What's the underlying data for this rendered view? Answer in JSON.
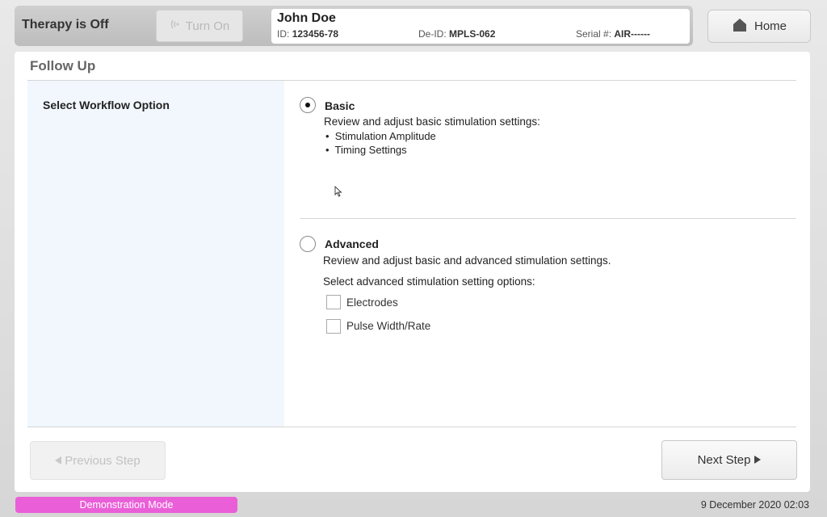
{
  "header": {
    "therapy_status": "Therapy is Off",
    "turn_on_label": "Turn On",
    "patient": {
      "name": "John Doe",
      "id_label": "ID:",
      "id_value": "123456-78",
      "deid_label": "De-ID:",
      "deid_value": "MPLS-062",
      "serial_label": "Serial #:",
      "serial_value": "AIR------"
    },
    "home_label": "Home"
  },
  "page": {
    "title": "Follow Up",
    "left_heading": "Select Workflow Option"
  },
  "options": {
    "basic": {
      "title": "Basic",
      "selected": true,
      "description": "Review and adjust basic stimulation settings:",
      "bullets": [
        "Stimulation Amplitude",
        "Timing Settings"
      ]
    },
    "advanced": {
      "title": "Advanced",
      "selected": false,
      "description": "Review and adjust basic and advanced stimulation settings.",
      "sub_heading": "Select advanced stimulation setting options:",
      "checkboxes": [
        {
          "label": "Electrodes",
          "checked": false
        },
        {
          "label": "Pulse Width/Rate",
          "checked": false
        }
      ]
    }
  },
  "nav": {
    "previous_label": "Previous Step",
    "next_label": "Next Step"
  },
  "footer": {
    "mode": "Demonstration Mode",
    "datetime": "9 December 2020 02:03"
  },
  "icons": {
    "signal": "signal-icon",
    "home": "home-icon",
    "prev": "triangle-left-icon",
    "next": "triangle-right-icon",
    "cursor": "mouse-cursor-icon"
  },
  "colors": {
    "demo_badge": "#ea5fd8",
    "left_column": "#f1f7fd"
  }
}
